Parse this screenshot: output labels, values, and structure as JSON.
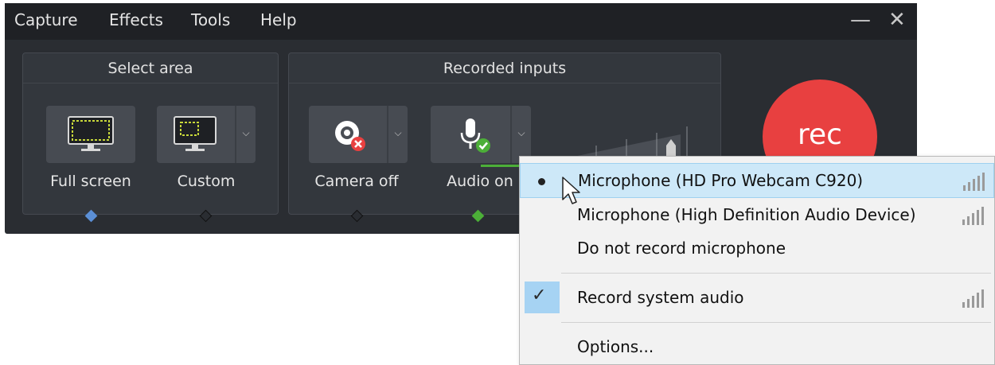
{
  "menu": {
    "items": [
      "Capture",
      "Effects",
      "Tools",
      "Help"
    ]
  },
  "window": {
    "minimize": "—",
    "close": "✕"
  },
  "select_area": {
    "title": "Select area",
    "full_screen": "Full screen",
    "custom": "Custom"
  },
  "recorded_inputs": {
    "title": "Recorded inputs",
    "camera": "Camera off",
    "audio": "Audio on"
  },
  "rec_button": "rec",
  "audio_menu": {
    "items": [
      "Microphone (HD Pro Webcam C920)",
      "Microphone (High Definition Audio Device)",
      "Do not record microphone",
      "Record system audio",
      "Options..."
    ],
    "selected_index": 0,
    "checked_index": 3
  },
  "colors": {
    "rec": "#e84040",
    "accent_green": "#4caf38",
    "accent_blue": "#5b8fd6",
    "highlight": "#cde8f8"
  },
  "icons": {
    "full_screen": "monitor-icon",
    "custom": "monitor-region-icon",
    "camera": "webcam-off-icon",
    "audio": "microphone-on-icon",
    "signal": "signal-bars-icon",
    "cursor": "arrow-cursor-icon"
  }
}
